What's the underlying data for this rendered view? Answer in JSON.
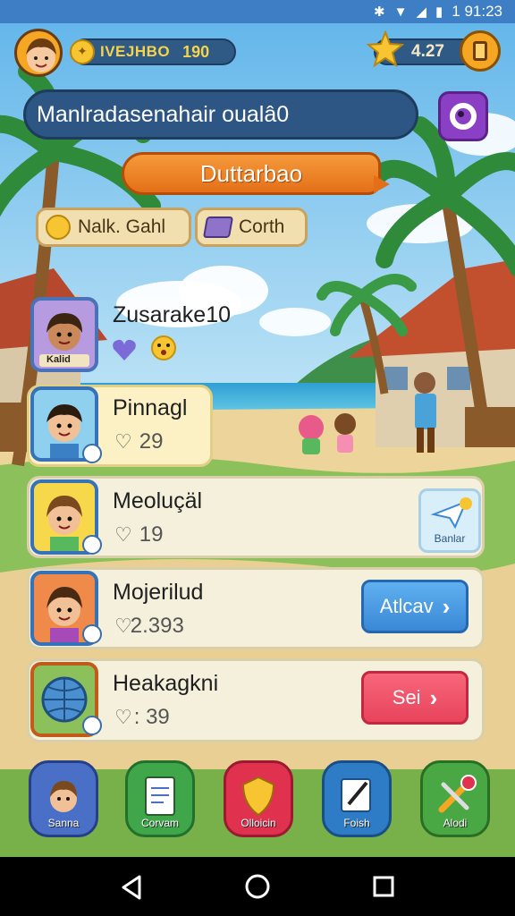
{
  "status_bar": {
    "time": "1 91:23"
  },
  "hud": {
    "coin_label": "IVEJHBO",
    "coin_value": "190",
    "star_value": "4.27"
  },
  "title": {
    "text": "Manlradasenahair oualâ0"
  },
  "banner": {
    "text": "Duttarbao"
  },
  "chips": [
    {
      "label": "Nalk. Gahl",
      "icon": "coin-icon"
    },
    {
      "label": "Corth",
      "icon": "box-icon"
    }
  ],
  "items": [
    {
      "name": "Zusarake10",
      "portrait_label": "Kalid"
    },
    {
      "name": "Pinnagl",
      "likes": "29"
    },
    {
      "name": "Meoluçäl",
      "likes": "19",
      "side_label": "Banlar"
    },
    {
      "name": "Mojerilud",
      "likes": "2.393",
      "button": "Atlcav"
    },
    {
      "name": "Heakagkni",
      "likes": ": 39",
      "button": "Sei"
    }
  ],
  "dock": [
    {
      "label": "Sanna",
      "color": "#4a6fc7",
      "icon": "character-icon"
    },
    {
      "label": "Corvam",
      "color": "#3fa64a",
      "icon": "notes-icon"
    },
    {
      "label": "Olloicin",
      "color": "#e0314f",
      "icon": "shield-icon"
    },
    {
      "label": "Foish",
      "color": "#2e7cc6",
      "icon": "edit-icon"
    },
    {
      "label": "Alodi",
      "color": "#49a843",
      "icon": "tools-icon"
    }
  ],
  "colors": {
    "accent_orange": "#e56f18",
    "panel_navy": "#2d5684",
    "action_blue": "#3a88d6",
    "action_red": "#e8445c",
    "title_purple": "#8a3fc5"
  }
}
